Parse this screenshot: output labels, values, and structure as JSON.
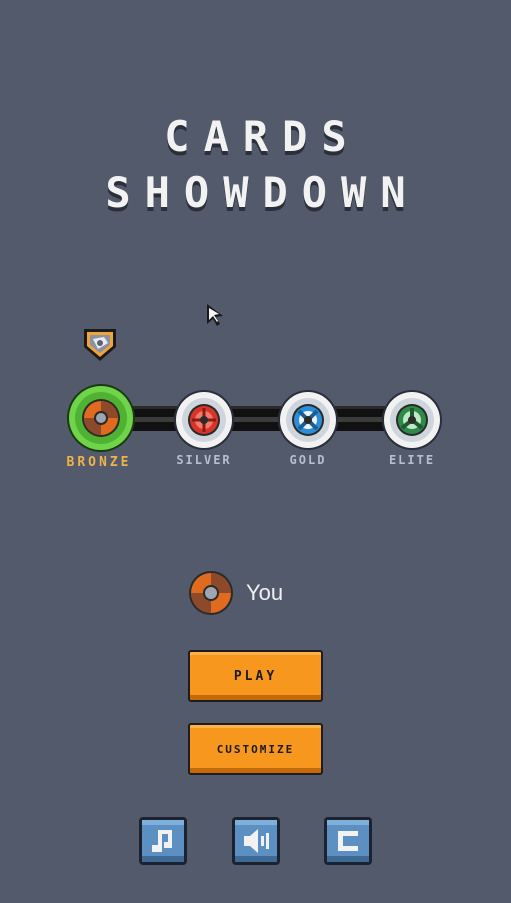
{
  "title": {
    "line1": "CARDS",
    "line2": "SHOWDOWN"
  },
  "tiers": [
    {
      "label": "BRONZE",
      "active": true
    },
    {
      "label": "SILVER",
      "active": false
    },
    {
      "label": "GOLD",
      "active": false
    },
    {
      "label": "ELITE",
      "active": false
    }
  ],
  "player": {
    "name": "You"
  },
  "buttons": {
    "play": "PLAY",
    "customize": "CUSTOMIZE"
  },
  "icons": {
    "music": "music-note-icon",
    "sound": "speaker-icon",
    "credits": "c-letter-icon"
  },
  "colors": {
    "background": "#525a6b",
    "accent": "#f7971e",
    "active_ring": "#6fd44a",
    "active_label": "#f2b24a"
  }
}
